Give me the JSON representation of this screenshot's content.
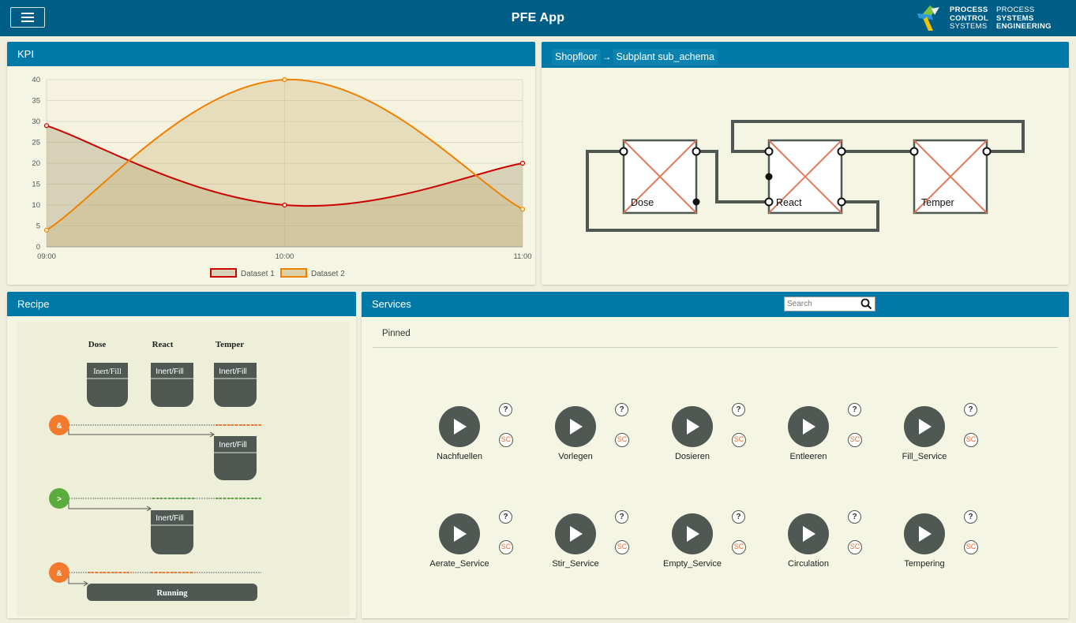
{
  "app": {
    "title": "PFE App"
  },
  "logo": {
    "line1": "PROCESS",
    "line2": "CONTROL",
    "line3": "SYSTEMS",
    "line4": "PROCESS",
    "line5": "SYSTEMS",
    "line6": "ENGINEERING"
  },
  "colors": {
    "topbar": "#005d85",
    "panel_header": "#0079a8",
    "panel_bg": "#f4f5e3",
    "page_bg": "#f0eedd",
    "dataset1": "#cc0000",
    "dataset2": "#f08000",
    "node": "#4f5852",
    "accent_orange": "#f37a2c",
    "accent_green": "#5aac3e"
  },
  "kpi": {
    "title": "KPI"
  },
  "chart_data": {
    "type": "line",
    "x": [
      "09:00",
      "10:00",
      "11:00"
    ],
    "series": [
      {
        "name": "Dataset 1",
        "values": [
          29,
          10,
          20
        ],
        "fill": true
      },
      {
        "name": "Dataset 2",
        "values": [
          4,
          40,
          9
        ],
        "fill": true
      }
    ],
    "ylim": [
      0,
      40
    ],
    "yticks": [
      0,
      5,
      10,
      15,
      20,
      25,
      30,
      35,
      40
    ],
    "grid": true,
    "legend": "bottom"
  },
  "plant": {
    "crumb1": "Shopfloor",
    "crumb_sep": "→",
    "crumb2": "Subplant sub_achema",
    "units": [
      {
        "label": "Dose"
      },
      {
        "label": "React"
      },
      {
        "label": "Temper"
      }
    ]
  },
  "recipe": {
    "title": "Recipe",
    "columns": [
      "Dose",
      "React",
      "Temper"
    ],
    "step_label": "Inert/Fill",
    "gates": [
      "&",
      ">",
      "&"
    ],
    "status": "Running"
  },
  "services": {
    "title": "Services",
    "search_placeholder": "Search",
    "pinned_label": "Pinned",
    "help_glyph": "?",
    "sc_badge": "SC",
    "items": [
      {
        "label": "Nachfuellen"
      },
      {
        "label": "Vorlegen"
      },
      {
        "label": "Dosieren"
      },
      {
        "label": "Entleeren"
      },
      {
        "label": "Fill_Service"
      },
      {
        "label": "Aerate_Service"
      },
      {
        "label": "Stir_Service"
      },
      {
        "label": "Empty_Service"
      },
      {
        "label": "Circulation"
      },
      {
        "label": "Tempering"
      }
    ]
  }
}
